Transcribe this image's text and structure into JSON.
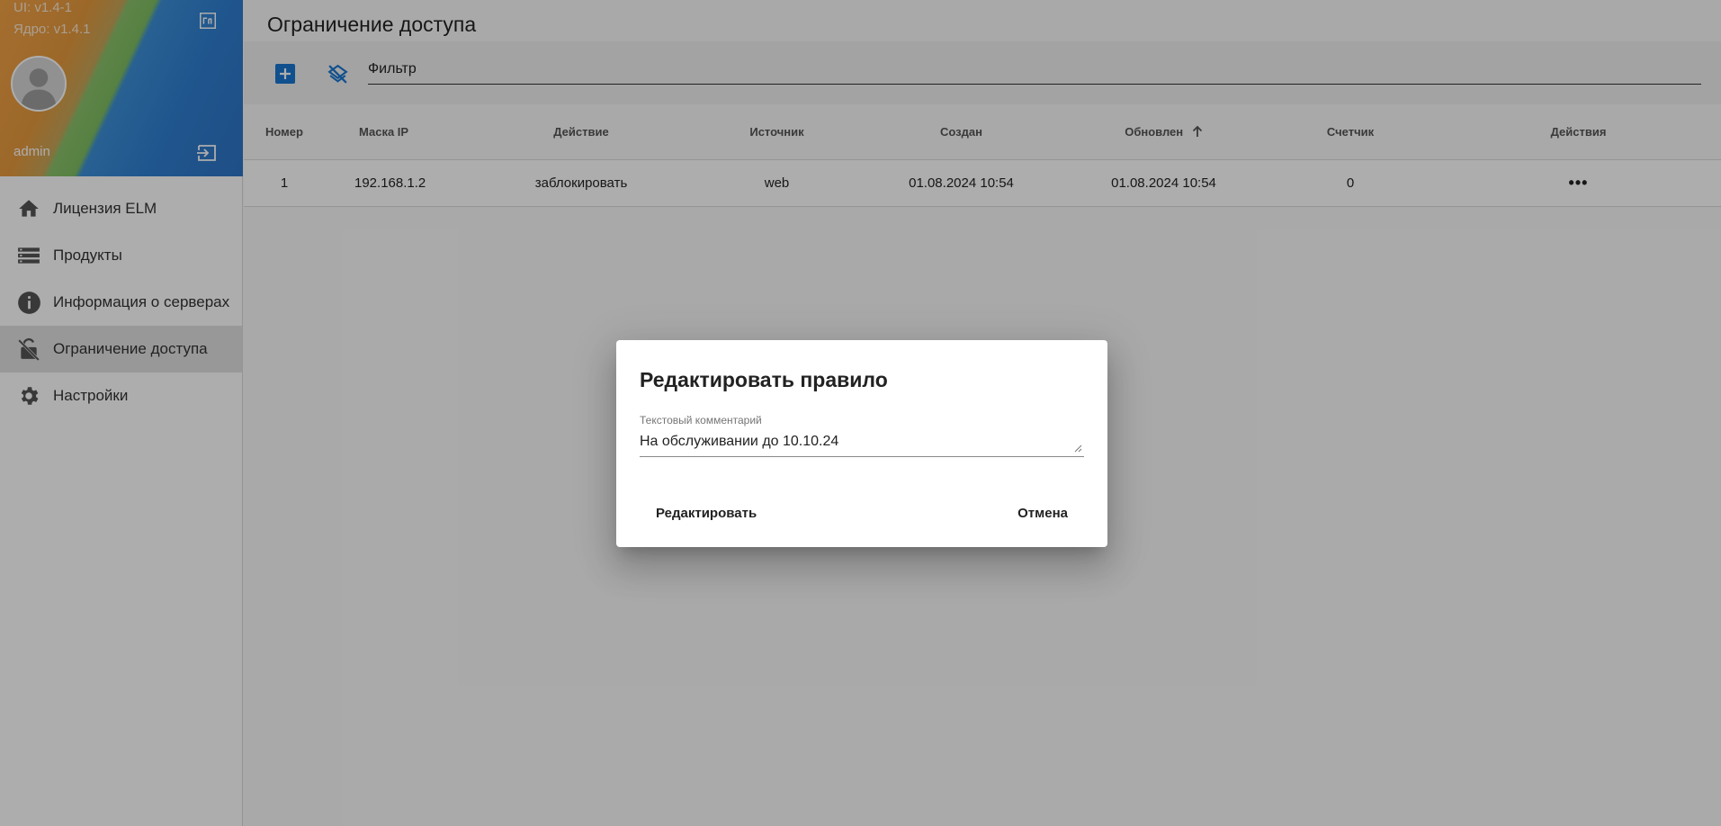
{
  "sidebar": {
    "ui_version": "UI: v1.4-1",
    "core_version": "Ядро: v1.4.1",
    "username": "admin",
    "items": [
      {
        "label": "Лицензия ELM",
        "icon": "home-icon"
      },
      {
        "label": "Продукты",
        "icon": "list-icon"
      },
      {
        "label": "Информация о серверах",
        "icon": "info-icon"
      },
      {
        "label": "Ограничение доступа",
        "icon": "lock-off-icon",
        "active": true
      },
      {
        "label": "Настройки",
        "icon": "gear-icon"
      }
    ]
  },
  "main": {
    "title": "Ограничение доступа",
    "filter_text": "Фильтр",
    "columns": [
      "Номер",
      "Маска IP",
      "Действие",
      "Источник",
      "Создан",
      "Обновлен",
      "Счетчик",
      "Действия"
    ],
    "rows": [
      {
        "number": "1",
        "ip_mask": "192.168.1.2",
        "action": "заблокировать",
        "source": "web",
        "created": "01.08.2024 10:54",
        "updated": "01.08.2024 10:54",
        "counter": "0",
        "actions": "•••"
      }
    ]
  },
  "dialog": {
    "title": "Редактировать правило",
    "field_label": "Текстовый комментарий",
    "field_value": "На обслуживании до 10.10.24",
    "confirm_label": "Редактировать",
    "cancel_label": "Отмена"
  },
  "colors": {
    "accent": "#1976d2",
    "overlay": "rgba(0,0,0,0.32)"
  }
}
